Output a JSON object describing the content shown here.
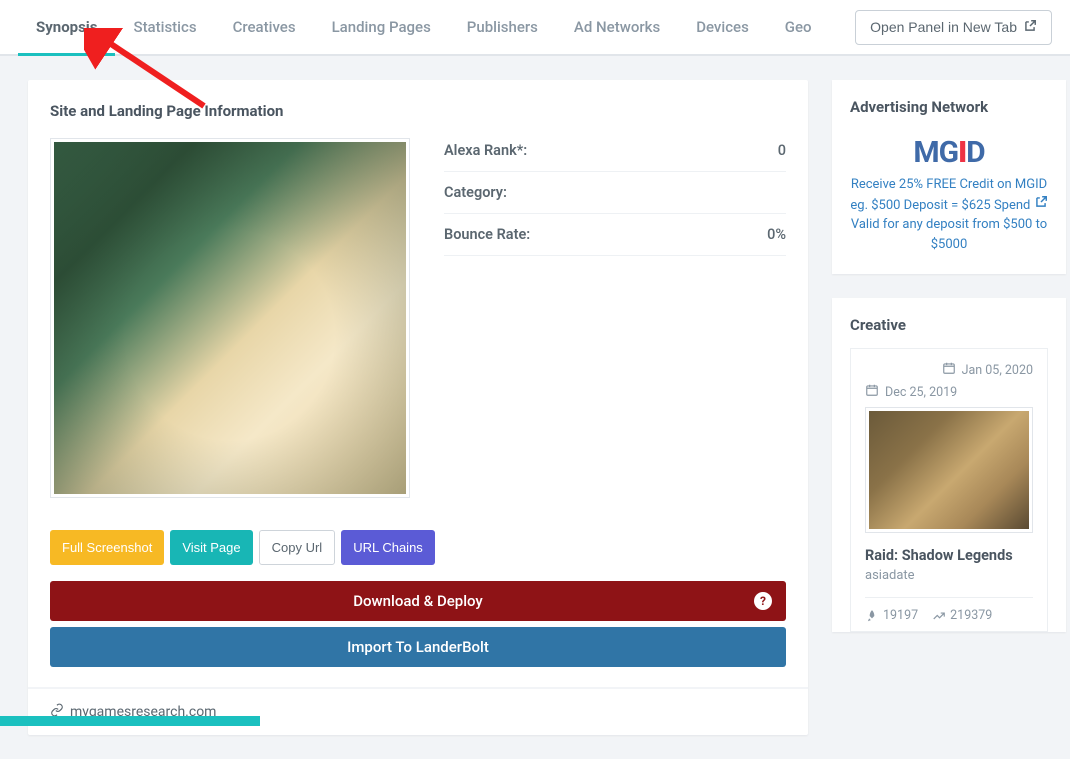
{
  "tabs": [
    "Synopsis",
    "Statistics",
    "Creatives",
    "Landing Pages",
    "Publishers",
    "Ad Networks",
    "Devices",
    "Geo"
  ],
  "active_tab": 0,
  "open_panel_label": "Open Panel in New Tab",
  "site_card": {
    "title": "Site and Landing Page Information",
    "meta": [
      {
        "label": "Alexa Rank*:",
        "value": "0"
      },
      {
        "label": "Category:",
        "value": ""
      },
      {
        "label": "Bounce Rate:",
        "value": "0%"
      }
    ],
    "buttons": {
      "full_screenshot": "Full Screenshot",
      "visit_page": "Visit Page",
      "copy_url": "Copy Url",
      "url_chains": "URL Chains"
    },
    "download_deploy": "Download & Deploy",
    "import_landerbolt": "Import To LanderBolt",
    "url": "mygamesresearch.com"
  },
  "ad_network": {
    "title": "Advertising Network",
    "logo": "MGID",
    "line1": "Receive 25% FREE Credit on MGID",
    "line2": "eg. $500 Deposit = $625 Spend",
    "line3": "Valid for any deposit from $500 to $5000"
  },
  "creative": {
    "title": "Creative",
    "date_end": "Jan 05, 2020",
    "date_start": "Dec 25, 2019",
    "item_title": "Raid: Shadow Legends",
    "item_sub": "asiadate",
    "stat1": "19197",
    "stat2": "219379"
  }
}
